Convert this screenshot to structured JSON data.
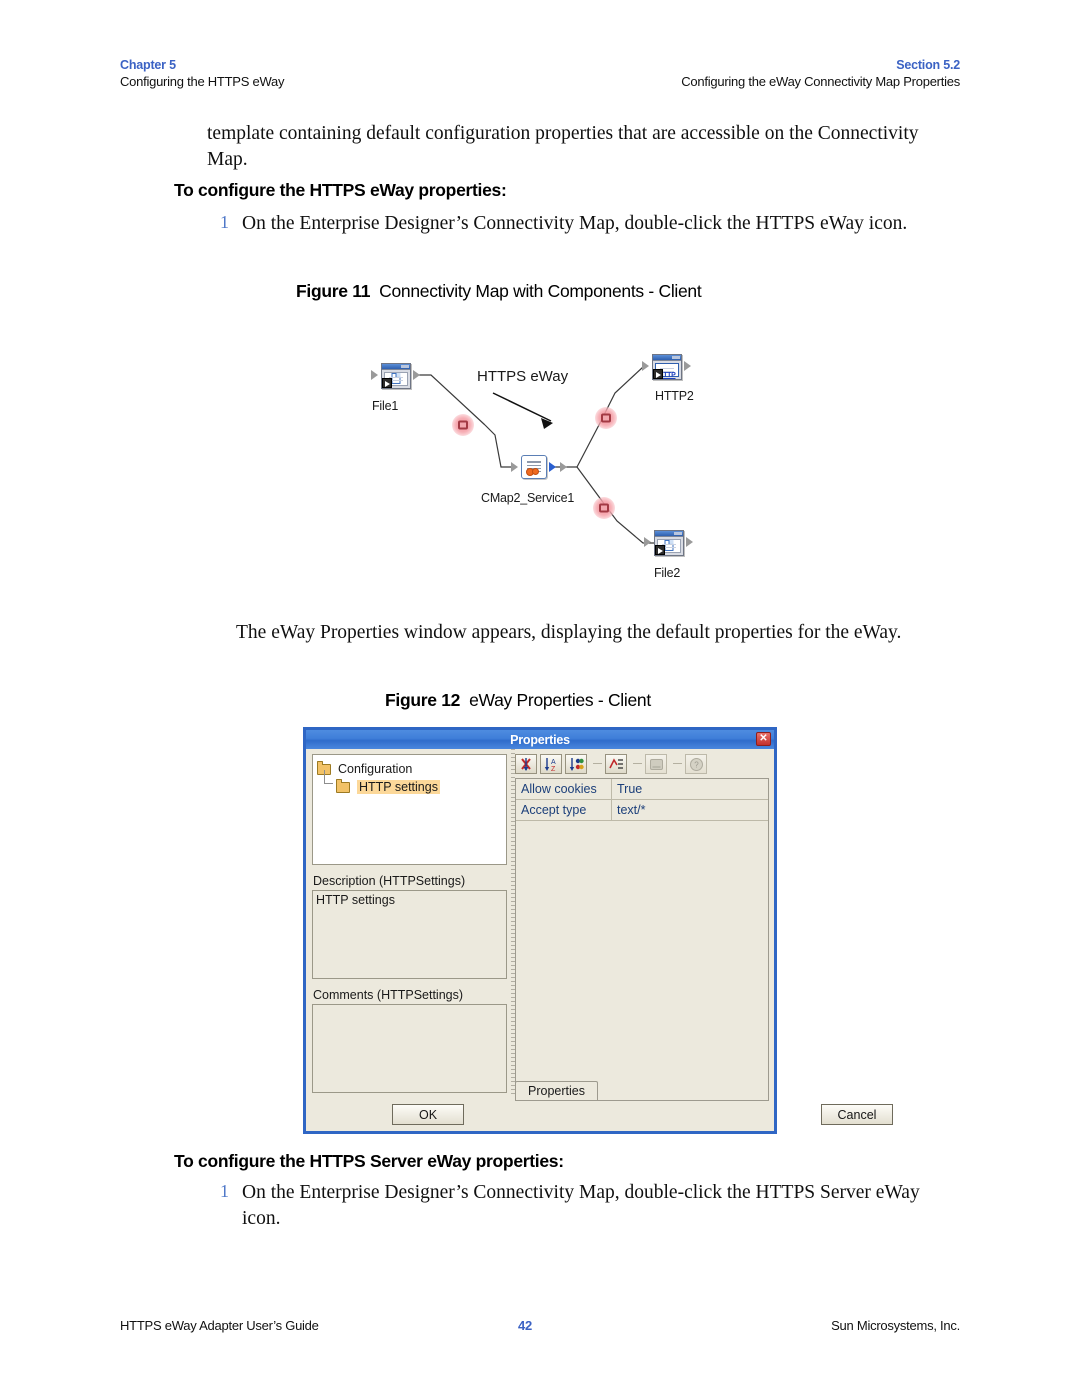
{
  "header": {
    "chapter_label": "Chapter 5",
    "chapter_title": "Configuring the HTTPS eWay",
    "section_label": "Section 5.2",
    "section_title": "Configuring the eWay Connectivity Map Properties"
  },
  "body": {
    "intro_paragraph": "template containing default configuration properties that are accessible on the Connectivity Map.",
    "heading_client": "To configure the HTTPS eWay properties:",
    "step_client_number": "1",
    "step_client_text": "On the Enterprise Designer’s Connectivity Map, double-click the HTTPS eWay icon.",
    "after_fig11_paragraph": "The eWay Properties window appears, displaying the default properties for the eWay.",
    "heading_server": "To configure the HTTPS Server eWay properties:",
    "step_server_number": "1",
    "step_server_text": "On the Enterprise Designer’s Connectivity Map, double-click the HTTPS Server eWay icon."
  },
  "figure11": {
    "caption_number": "Figure 11",
    "caption_title": "Connectivity Map with Components - Client",
    "nodes": {
      "file1": "File1",
      "http2": "HTTP2",
      "service": "CMap2_Service1",
      "file2": "File2",
      "http_text": "HTTP"
    },
    "annotation": "HTTPS eWay"
  },
  "figure12": {
    "caption_number": "Figure 12",
    "caption_title": "eWay Properties - Client",
    "dialog": {
      "title": "Properties",
      "close_label": "✕",
      "tree": {
        "root": "Configuration",
        "child": "HTTP settings"
      },
      "description_label": "Description (HTTPSettings)",
      "description_value": "HTTP settings",
      "comments_label": "Comments (HTTPSettings)",
      "comments_value": "",
      "toolbar": [
        {
          "name": "sort-categorized-icon",
          "enabled": true
        },
        {
          "name": "sort-alphabetic-icon",
          "enabled": true
        },
        {
          "name": "sort-mixed-icon",
          "enabled": true
        },
        {
          "name": "show-description-icon",
          "enabled": true
        },
        {
          "name": "page-icon",
          "enabled": false
        },
        {
          "name": "help-icon",
          "enabled": false
        }
      ],
      "grid": {
        "rows": [
          {
            "key": "Allow cookies",
            "value": "True"
          },
          {
            "key": "Accept type",
            "value": "text/*"
          }
        ]
      },
      "tab_label": "Properties",
      "ok_label": "OK",
      "cancel_label": "Cancel"
    }
  },
  "footer": {
    "left": "HTTPS eWay Adapter User’s Guide",
    "page": "42",
    "right": "Sun Microsystems, Inc."
  },
  "colors": {
    "accent_blue": "#3b62c4",
    "dialog_border": "#2f66c4",
    "dialog_face": "#ece9dd",
    "highlight": "#fcd899",
    "connector_pink": "#f38c96"
  }
}
